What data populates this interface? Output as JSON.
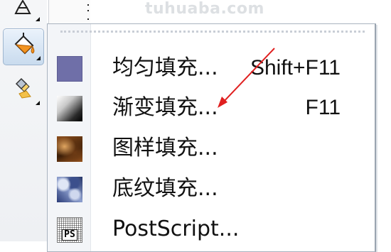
{
  "watermark": "tuhuaba.com",
  "toolbox": {
    "tools": [
      {
        "name": "outline-tool",
        "icon": "pen-nib-icon",
        "active": false
      },
      {
        "name": "fill-tool",
        "icon": "paint-bucket-icon",
        "active": true
      },
      {
        "name": "interactive-fill-tool",
        "icon": "interactive-fill-icon",
        "active": false
      }
    ]
  },
  "menu": {
    "items": [
      {
        "label": "均匀填充...",
        "shortcut": "Shift+F11",
        "swatch": "uniform-fill-swatch",
        "color": "#6f6fa8"
      },
      {
        "label": "渐变填充...",
        "shortcut": "F11",
        "swatch": "gradient-fill-swatch"
      },
      {
        "label": "图样填充...",
        "shortcut": "",
        "swatch": "pattern-fill-swatch"
      },
      {
        "label": "底纹填充...",
        "shortcut": "",
        "swatch": "texture-fill-swatch"
      },
      {
        "label": "PostScript...",
        "shortcut": "",
        "swatch": "postscript-fill-swatch",
        "swatch_text": "PS"
      }
    ]
  },
  "annotation": {
    "color": "#e02020",
    "points_to": "渐变填充..."
  }
}
